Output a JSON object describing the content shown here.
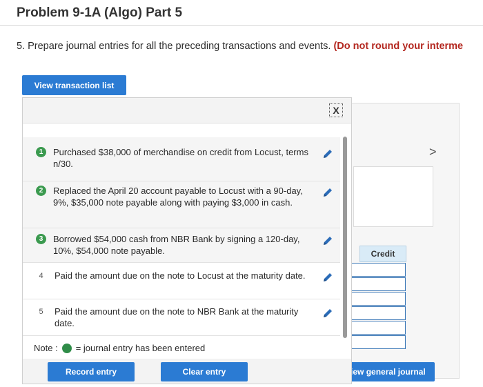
{
  "page": {
    "title": "Problem 9-1A (Algo) Part 5",
    "instruction_main": "5. Prepare journal entries for all the preceding transactions and events.",
    "instruction_note": "(Do not round your interme"
  },
  "buttons": {
    "view_transaction_list": "View transaction list",
    "record_entry": "Record entry",
    "clear_entry": "Clear entry",
    "view_general_journal": "View general journal"
  },
  "popup": {
    "close_label": "X",
    "transactions": [
      {
        "number": "1",
        "entered": true,
        "text": "Purchased $38,000 of merchandise on credit from Locust, terms n/30."
      },
      {
        "number": "2",
        "entered": true,
        "text": "Replaced the April 20 account payable to Locust with a 90-day, 9%, $35,000 note payable along with paying $3,000 in cash."
      },
      {
        "number": "3",
        "entered": true,
        "text": "Borrowed $54,000 cash from NBR Bank by signing a 120-day, 10%, $54,000 note payable."
      },
      {
        "number": "4",
        "entered": false,
        "text": "Paid the amount due on the note to Locust at the maturity date."
      },
      {
        "number": "5",
        "entered": false,
        "text": "Paid the amount due on the note to NBR Bank at the maturity date."
      }
    ],
    "note_label": "Note :",
    "note_text": "= journal entry has been entered"
  },
  "journal": {
    "credit_header": "Credit",
    "chevron": ">"
  },
  "colors": {
    "button_blue": "#2b7bd3",
    "entered_green": "#3b9a4f",
    "instruction_red": "#b3261e",
    "cell_border_blue": "#3f7ab8"
  },
  "icons": {
    "edit": "pencil-icon",
    "close": "close-icon",
    "next": "chevron-right-icon"
  }
}
